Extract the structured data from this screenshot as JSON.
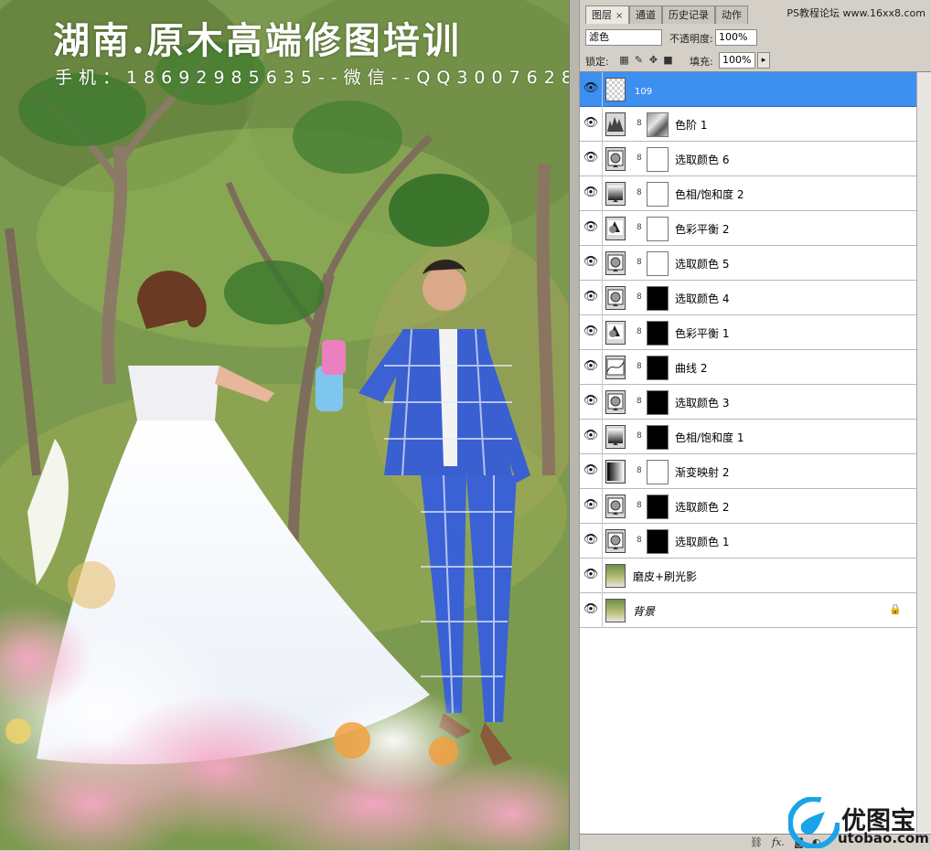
{
  "photo": {
    "watermark_title": "湖南.原木高端修图培训",
    "watermark_phone": "手机：18692985635--微信--QQ",
    "watermark_number": "3007628"
  },
  "panel": {
    "tabs": [
      {
        "label": "图层",
        "active": true,
        "close": "×"
      },
      {
        "label": "通道",
        "active": false
      },
      {
        "label": "历史记录",
        "active": false
      },
      {
        "label": "动作",
        "active": false
      }
    ],
    "forum_watermark": "PS教程论坛 www.16xx8.com",
    "blend_mode": "滤色",
    "opacity_label": "不透明度:",
    "opacity_value": "100%",
    "lock_label": "锁定:",
    "fill_label": "填充:",
    "fill_value": "100%",
    "fill_arrow": "▸",
    "layers": [
      {
        "name": "109",
        "type": "pixel-transparent",
        "selected": true
      },
      {
        "name": "色阶 1",
        "type": "levels",
        "mask": "levels"
      },
      {
        "name": "选取颜色 6",
        "type": "selective-color",
        "mask": "white"
      },
      {
        "name": "色相/饱和度 2",
        "type": "hue-sat",
        "mask": "white"
      },
      {
        "name": "色彩平衡 2",
        "type": "color-balance",
        "mask": "white"
      },
      {
        "name": "选取颜色 5",
        "type": "selective-color",
        "mask": "white"
      },
      {
        "name": "选取颜色 4",
        "type": "selective-color",
        "mask": "black"
      },
      {
        "name": "色彩平衡 1",
        "type": "color-balance",
        "mask": "black"
      },
      {
        "name": "曲线 2",
        "type": "curves",
        "mask": "black"
      },
      {
        "name": "选取颜色 3",
        "type": "selective-color",
        "mask": "black"
      },
      {
        "name": "色相/饱和度 1",
        "type": "hue-sat",
        "mask": "black"
      },
      {
        "name": "渐变映射 2",
        "type": "gradient-map",
        "mask": "white"
      },
      {
        "name": "选取颜色 2",
        "type": "selective-color",
        "mask": "black"
      },
      {
        "name": "选取颜色 1",
        "type": "selective-color",
        "mask": "black"
      },
      {
        "name": "磨皮+刷光影",
        "type": "photo"
      },
      {
        "name": "背景",
        "type": "photo",
        "locked": true
      }
    ],
    "bottom_icons": [
      "link-icon",
      "fx-icon",
      "mask-icon",
      "adjustment-icon",
      "folder-icon",
      "new-layer-icon",
      "trash-icon"
    ],
    "bottom_fx_label": "fx."
  },
  "brand": {
    "name": "优图宝",
    "url": "utobao.com",
    "color": "#1aa3e8"
  },
  "colors": {
    "selection": "#3d8ff0",
    "panel_chrome": "#d4d0c8"
  }
}
